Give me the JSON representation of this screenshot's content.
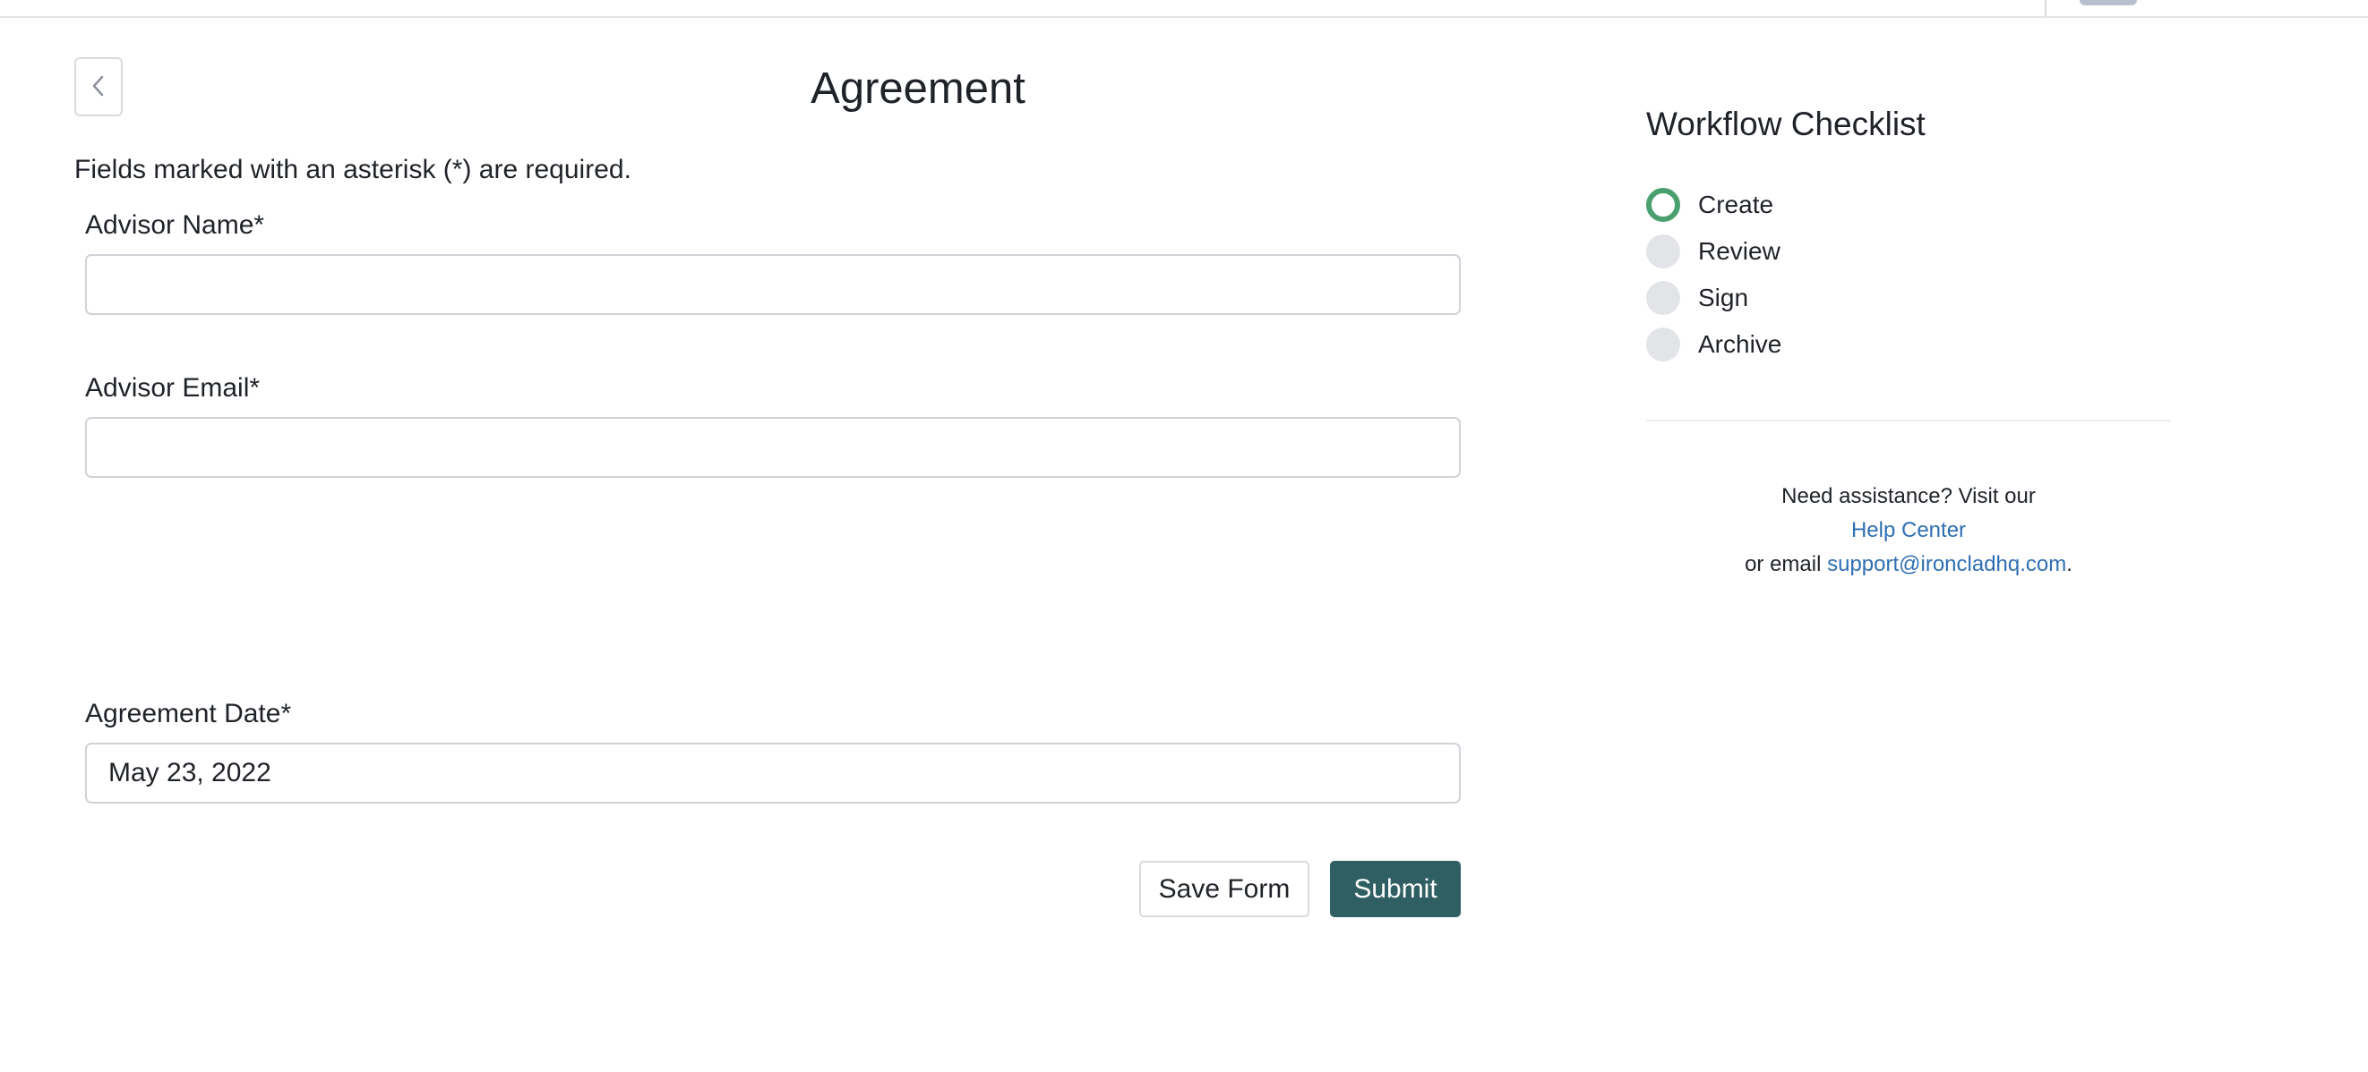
{
  "form": {
    "title": "Agreement",
    "required_note": "Fields marked with an asterisk (*) are required.",
    "fields": [
      {
        "label": "Advisor Name*",
        "value": "",
        "placeholder": ""
      },
      {
        "label": "Advisor Email*",
        "value": "",
        "placeholder": ""
      },
      {
        "label": "Agreement Date*",
        "value": "May 23, 2022",
        "placeholder": ""
      }
    ],
    "buttons": {
      "save_label": "Save Form",
      "submit_label": "Submit"
    }
  },
  "sidebar": {
    "title": "Workflow Checklist",
    "steps": [
      {
        "label": "Create",
        "status": "active"
      },
      {
        "label": "Review",
        "status": "pending"
      },
      {
        "label": "Sign",
        "status": "pending"
      },
      {
        "label": "Archive",
        "status": "pending"
      }
    ],
    "help": {
      "line1": "Need assistance? Visit our",
      "link_text": "Help Center",
      "email_prefix": "or email ",
      "email": "support@ironcladhq.com",
      "email_suffix": "."
    }
  },
  "colors": {
    "accent": "#2f5f63",
    "active_step": "#49a06e",
    "link": "#2f6fb3"
  },
  "icons": {
    "back": "chevron-left-icon"
  }
}
